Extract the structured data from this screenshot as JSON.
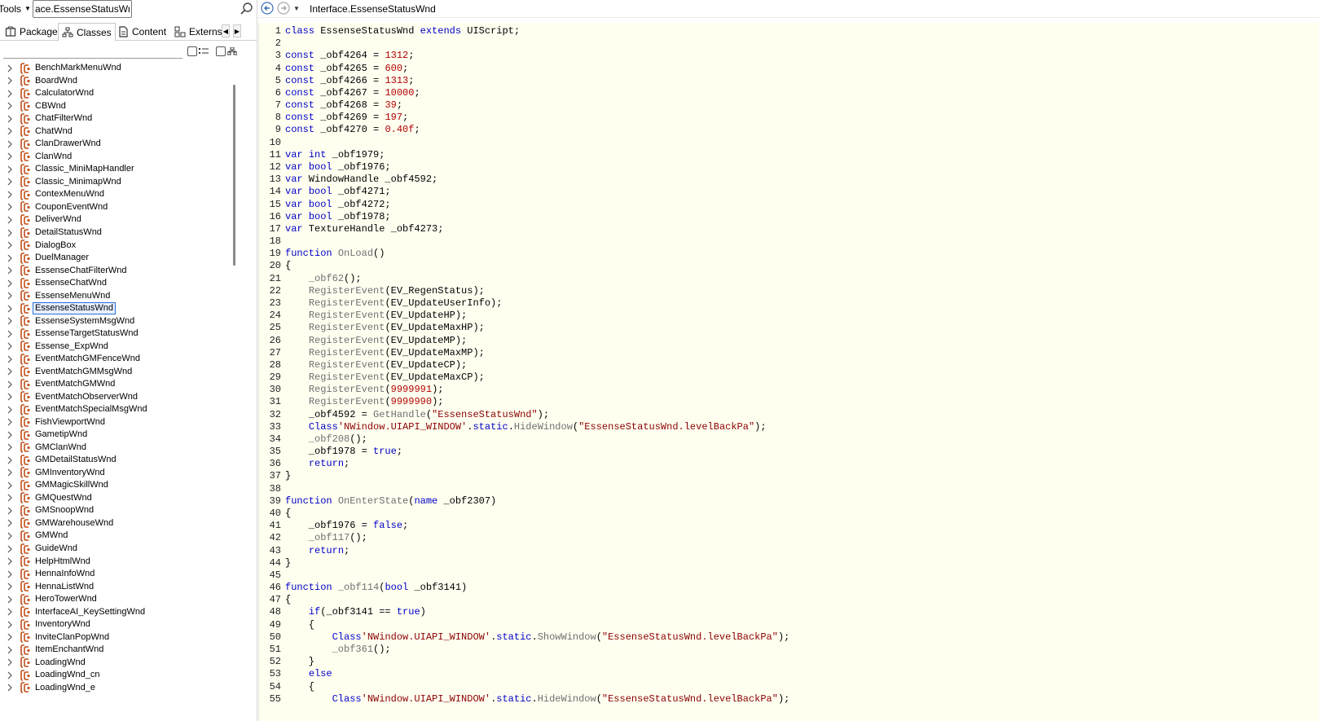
{
  "toolbar": {
    "tools_label": "Tools",
    "search_value": "ace.EssenseStatusWnd"
  },
  "tabs": [
    {
      "label": "Package",
      "icon": "package-icon"
    },
    {
      "label": "Classes",
      "icon": "class-tree-icon"
    },
    {
      "label": "Content",
      "icon": "content-icon"
    },
    {
      "label": "Externs",
      "icon": "externs-icon"
    }
  ],
  "active_tab": "Classes",
  "tree": {
    "selected": "EssenseStatusWnd",
    "items": [
      "BenchMarkMenuWnd",
      "BoardWnd",
      "CalculatorWnd",
      "CBWnd",
      "ChatFilterWnd",
      "ChatWnd",
      "ClanDrawerWnd",
      "ClanWnd",
      "Classic_MiniMapHandler",
      "Classic_MinimapWnd",
      "ContexMenuWnd",
      "CouponEventWnd",
      "DeliverWnd",
      "DetailStatusWnd",
      "DialogBox",
      "DuelManager",
      "EssenseChatFilterWnd",
      "EssenseChatWnd",
      "EssenseMenuWnd",
      "EssenseStatusWnd",
      "EssenseSystemMsgWnd",
      "EssenseTargetStatusWnd",
      "Essense_ExpWnd",
      "EventMatchGMFenceWnd",
      "EventMatchGMMsgWnd",
      "EventMatchGMWnd",
      "EventMatchObserverWnd",
      "EventMatchSpecialMsgWnd",
      "FishViewportWnd",
      "GametipWnd",
      "GMClanWnd",
      "GMDetailStatusWnd",
      "GMInventoryWnd",
      "GMMagicSkillWnd",
      "GMQuestWnd",
      "GMSnoopWnd",
      "GMWarehouseWnd",
      "GMWnd",
      "GuideWnd",
      "HelpHtmlWnd",
      "HennaInfoWnd",
      "HennaListWnd",
      "HeroTowerWnd",
      "InterfaceAI_KeySettingWnd",
      "InventoryWnd",
      "InviteClanPopWnd",
      "ItemEnchantWnd",
      "LoadingWnd",
      "LoadingWnd_cn",
      "LoadingWnd_e"
    ]
  },
  "nav": {
    "path": "Interface.EssenseStatusWnd"
  },
  "code": [
    [
      [
        "kw",
        "class"
      ],
      [
        "pl",
        " EssenseStatusWnd "
      ],
      [
        "kw",
        "extends"
      ],
      [
        "pl",
        " UIScript;"
      ]
    ],
    [],
    [
      [
        "kw",
        "const"
      ],
      [
        "pl",
        " _obf4264 = "
      ],
      [
        "num",
        "1312"
      ],
      [
        "pl",
        ";"
      ]
    ],
    [
      [
        "kw",
        "const"
      ],
      [
        "pl",
        " _obf4265 = "
      ],
      [
        "num",
        "600"
      ],
      [
        "pl",
        ";"
      ]
    ],
    [
      [
        "kw",
        "const"
      ],
      [
        "pl",
        " _obf4266 = "
      ],
      [
        "num",
        "1313"
      ],
      [
        "pl",
        ";"
      ]
    ],
    [
      [
        "kw",
        "const"
      ],
      [
        "pl",
        " _obf4267 = "
      ],
      [
        "num",
        "10000"
      ],
      [
        "pl",
        ";"
      ]
    ],
    [
      [
        "kw",
        "const"
      ],
      [
        "pl",
        " _obf4268 = "
      ],
      [
        "num",
        "39"
      ],
      [
        "pl",
        ";"
      ]
    ],
    [
      [
        "kw",
        "const"
      ],
      [
        "pl",
        " _obf4269 = "
      ],
      [
        "num",
        "197"
      ],
      [
        "pl",
        ";"
      ]
    ],
    [
      [
        "kw",
        "const"
      ],
      [
        "pl",
        " _obf4270 = "
      ],
      [
        "num",
        "0.40f"
      ],
      [
        "pl",
        ";"
      ]
    ],
    [],
    [
      [
        "kw",
        "var"
      ],
      [
        "pl",
        " "
      ],
      [
        "kw",
        "int"
      ],
      [
        "pl",
        " _obf1979;"
      ]
    ],
    [
      [
        "kw",
        "var"
      ],
      [
        "pl",
        " "
      ],
      [
        "kw",
        "bool"
      ],
      [
        "pl",
        " _obf1976;"
      ]
    ],
    [
      [
        "kw",
        "var"
      ],
      [
        "pl",
        " WindowHandle _obf4592;"
      ]
    ],
    [
      [
        "kw",
        "var"
      ],
      [
        "pl",
        " "
      ],
      [
        "kw",
        "bool"
      ],
      [
        "pl",
        " _obf4271;"
      ]
    ],
    [
      [
        "kw",
        "var"
      ],
      [
        "pl",
        " "
      ],
      [
        "kw",
        "bool"
      ],
      [
        "pl",
        " _obf4272;"
      ]
    ],
    [
      [
        "kw",
        "var"
      ],
      [
        "pl",
        " "
      ],
      [
        "kw",
        "bool"
      ],
      [
        "pl",
        " _obf1978;"
      ]
    ],
    [
      [
        "kw",
        "var"
      ],
      [
        "pl",
        " TextureHandle _obf4273;"
      ]
    ],
    [],
    [
      [
        "kw",
        "function"
      ],
      [
        "pl",
        " "
      ],
      [
        "fn",
        "OnLoad"
      ],
      [
        "pl",
        "()"
      ]
    ],
    [
      [
        "pl",
        "{"
      ]
    ],
    [
      [
        "pl",
        "    "
      ],
      [
        "fn",
        "_obf62"
      ],
      [
        "pl",
        "();"
      ]
    ],
    [
      [
        "pl",
        "    "
      ],
      [
        "fn",
        "RegisterEvent"
      ],
      [
        "pl",
        "(EV_RegenStatus);"
      ]
    ],
    [
      [
        "pl",
        "    "
      ],
      [
        "fn",
        "RegisterEvent"
      ],
      [
        "pl",
        "(EV_UpdateUserInfo);"
      ]
    ],
    [
      [
        "pl",
        "    "
      ],
      [
        "fn",
        "RegisterEvent"
      ],
      [
        "pl",
        "(EV_UpdateHP);"
      ]
    ],
    [
      [
        "pl",
        "    "
      ],
      [
        "fn",
        "RegisterEvent"
      ],
      [
        "pl",
        "(EV_UpdateMaxHP);"
      ]
    ],
    [
      [
        "pl",
        "    "
      ],
      [
        "fn",
        "RegisterEvent"
      ],
      [
        "pl",
        "(EV_UpdateMP);"
      ]
    ],
    [
      [
        "pl",
        "    "
      ],
      [
        "fn",
        "RegisterEvent"
      ],
      [
        "pl",
        "(EV_UpdateMaxMP);"
      ]
    ],
    [
      [
        "pl",
        "    "
      ],
      [
        "fn",
        "RegisterEvent"
      ],
      [
        "pl",
        "(EV_UpdateCP);"
      ]
    ],
    [
      [
        "pl",
        "    "
      ],
      [
        "fn",
        "RegisterEvent"
      ],
      [
        "pl",
        "(EV_UpdateMaxCP);"
      ]
    ],
    [
      [
        "pl",
        "    "
      ],
      [
        "fn",
        "RegisterEvent"
      ],
      [
        "pl",
        "("
      ],
      [
        "num",
        "9999991"
      ],
      [
        "pl",
        ");"
      ]
    ],
    [
      [
        "pl",
        "    "
      ],
      [
        "fn",
        "RegisterEvent"
      ],
      [
        "pl",
        "("
      ],
      [
        "num",
        "9999990"
      ],
      [
        "pl",
        ");"
      ]
    ],
    [
      [
        "pl",
        "    _obf4592 = "
      ],
      [
        "fn",
        "GetHandle"
      ],
      [
        "pl",
        "("
      ],
      [
        "str",
        "\"EssenseStatusWnd\""
      ],
      [
        "pl",
        ");"
      ]
    ],
    [
      [
        "pl",
        "    "
      ],
      [
        "kw",
        "Class"
      ],
      [
        "str",
        "'NWindow.UIAPI_WINDOW'"
      ],
      [
        "pl",
        "."
      ],
      [
        "kw",
        "static"
      ],
      [
        "pl",
        "."
      ],
      [
        "fn",
        "HideWindow"
      ],
      [
        "pl",
        "("
      ],
      [
        "str",
        "\"EssenseStatusWnd.levelBackPa\""
      ],
      [
        "pl",
        ");"
      ]
    ],
    [
      [
        "pl",
        "    "
      ],
      [
        "fn",
        "_obf208"
      ],
      [
        "pl",
        "();"
      ]
    ],
    [
      [
        "pl",
        "    _obf1978 = "
      ],
      [
        "kw",
        "true"
      ],
      [
        "pl",
        ";"
      ]
    ],
    [
      [
        "pl",
        "    "
      ],
      [
        "kw",
        "return"
      ],
      [
        "pl",
        ";"
      ]
    ],
    [
      [
        "pl",
        "}"
      ]
    ],
    [],
    [
      [
        "kw",
        "function"
      ],
      [
        "pl",
        " "
      ],
      [
        "fn",
        "OnEnterState"
      ],
      [
        "pl",
        "("
      ],
      [
        "kw",
        "name"
      ],
      [
        "pl",
        " _obf2307)"
      ]
    ],
    [
      [
        "pl",
        "{"
      ]
    ],
    [
      [
        "pl",
        "    _obf1976 = "
      ],
      [
        "kw",
        "false"
      ],
      [
        "pl",
        ";"
      ]
    ],
    [
      [
        "pl",
        "    "
      ],
      [
        "fn",
        "_obf117"
      ],
      [
        "pl",
        "();"
      ]
    ],
    [
      [
        "pl",
        "    "
      ],
      [
        "kw",
        "return"
      ],
      [
        "pl",
        ";"
      ]
    ],
    [
      [
        "pl",
        "}"
      ]
    ],
    [],
    [
      [
        "kw",
        "function"
      ],
      [
        "pl",
        " "
      ],
      [
        "fn",
        "_obf114"
      ],
      [
        "pl",
        "("
      ],
      [
        "kw",
        "bool"
      ],
      [
        "pl",
        " _obf3141)"
      ]
    ],
    [
      [
        "pl",
        "{"
      ]
    ],
    [
      [
        "pl",
        "    "
      ],
      [
        "kw",
        "if"
      ],
      [
        "pl",
        "(_obf3141 == "
      ],
      [
        "kw",
        "true"
      ],
      [
        "pl",
        ")"
      ]
    ],
    [
      [
        "pl",
        "    {"
      ]
    ],
    [
      [
        "pl",
        "        "
      ],
      [
        "kw",
        "Class"
      ],
      [
        "str",
        "'NWindow.UIAPI_WINDOW'"
      ],
      [
        "pl",
        "."
      ],
      [
        "kw",
        "static"
      ],
      [
        "pl",
        "."
      ],
      [
        "fn",
        "ShowWindow"
      ],
      [
        "pl",
        "("
      ],
      [
        "str",
        "\"EssenseStatusWnd.levelBackPa\""
      ],
      [
        "pl",
        ");"
      ]
    ],
    [
      [
        "pl",
        "        "
      ],
      [
        "fn",
        "_obf361"
      ],
      [
        "pl",
        "();"
      ]
    ],
    [
      [
        "pl",
        "    }"
      ]
    ],
    [
      [
        "pl",
        "    "
      ],
      [
        "kw",
        "else"
      ]
    ],
    [
      [
        "pl",
        "    {"
      ]
    ],
    [
      [
        "pl",
        "        "
      ],
      [
        "kw",
        "Class"
      ],
      [
        "str",
        "'NWindow.UIAPI_WINDOW'"
      ],
      [
        "pl",
        "."
      ],
      [
        "kw",
        "static"
      ],
      [
        "pl",
        "."
      ],
      [
        "fn",
        "HideWindow"
      ],
      [
        "pl",
        "("
      ],
      [
        "str",
        "\"EssenseStatusWnd.levelBackPa\""
      ],
      [
        "pl",
        ");"
      ]
    ]
  ],
  "colors": {
    "editor_bg": "#fffff0",
    "keyword": "#0000c8",
    "function": "#707070",
    "number": "#b00000",
    "string": "#8b0000",
    "class_icon": "#c0501a",
    "selection_border": "#2a6fd6"
  }
}
